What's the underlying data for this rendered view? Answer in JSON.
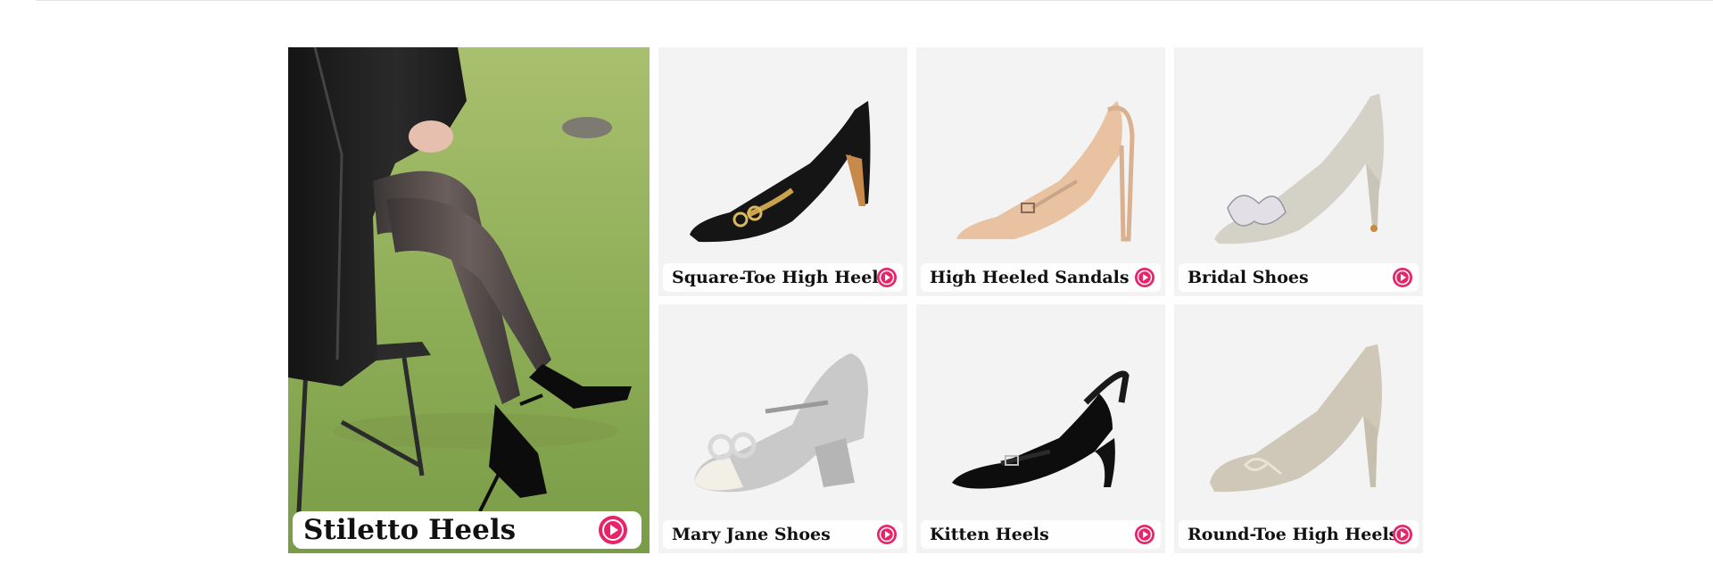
{
  "colors": {
    "accent": "#e8236a",
    "card_bg": "#f3f3f3",
    "grass": "#8fae58"
  },
  "hero": {
    "title": "Stiletto Heels",
    "icon": "play-circle-icon"
  },
  "categories": [
    {
      "label": "Square-Toe High Heels",
      "icon": "play-circle-icon"
    },
    {
      "label": "High Heeled Sandals",
      "icon": "play-circle-icon"
    },
    {
      "label": "Bridal Shoes",
      "icon": "play-circle-icon"
    },
    {
      "label": "Mary Jane Shoes",
      "icon": "play-circle-icon"
    },
    {
      "label": "Kitten Heels",
      "icon": "play-circle-icon"
    },
    {
      "label": "Round-Toe High Heels",
      "icon": "play-circle-icon"
    }
  ]
}
